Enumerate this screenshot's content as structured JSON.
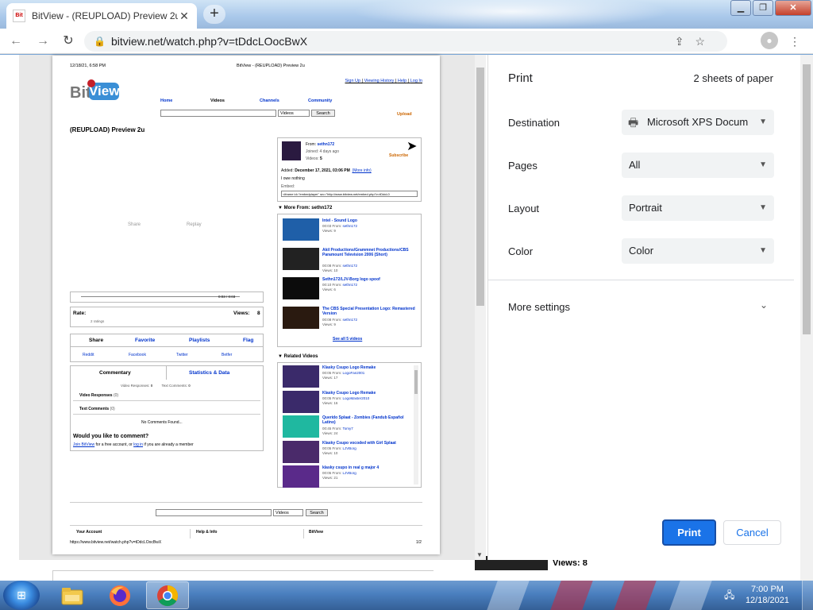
{
  "browser": {
    "tab_title": "BitView - (REUPLOAD) Preview 2u",
    "tab_favicon": "Bit",
    "url": "bitview.net/watch.php?v=tDdcLOocBwX"
  },
  "sheet": {
    "header_datetime": "12/18/21, 6:58 PM",
    "header_title": "BitView - (REUPLOAD) Preview 2u",
    "logo_bit": "Bit",
    "logo_view": "View",
    "toplinks": {
      "signup": "Sign Up",
      "history": "Viewing History",
      "help": "Help",
      "login": "Log In"
    },
    "nav": {
      "home": "Home",
      "videos": "Videos",
      "channels": "Channels",
      "community": "Community"
    },
    "search": {
      "select": "Videos",
      "button": "Search"
    },
    "upload": "Upload",
    "video_title": "(REUPLOAD) Preview 2u",
    "player": {
      "share": "Share",
      "replay": "Replay",
      "time": "0:03 / 0:03"
    },
    "rate": {
      "label": "Rate:",
      "ratings": "2 ratings",
      "views_label": "Views:",
      "views": "8"
    },
    "action_tabs": {
      "share": "Share",
      "favorite": "Favorite",
      "playlists": "Playlists",
      "flag": "Flag"
    },
    "share_links": {
      "reddit": "Reddit",
      "facebook": "Facebook",
      "twitter": "Twitter",
      "bsky": "Betfer"
    },
    "comment_tabs": {
      "commentary": "Commentary",
      "stats": "Statistics & Data"
    },
    "responses": {
      "video_responses_label": "Video Responses:",
      "video_responses": "0",
      "text_comments_label": "Text Comments:",
      "text_comments": "0"
    },
    "video_responses_heading": "Video Responses",
    "video_responses_count": "(0)",
    "text_comments_heading": "Text Comments",
    "text_comments_count": "(0)",
    "no_comments": "No Comments Found...",
    "would_like": "Would you like to comment?",
    "join_text_1": "Join BitView",
    "join_text_2": " for a free account, or ",
    "join_text_3": "log in",
    "join_text_4": " if you are already a member",
    "uploader": {
      "from_label": "From:",
      "from": "sethn172",
      "joined": "Joined: 4 days ago",
      "videos_label": "Videos:",
      "videos": "5",
      "subscribe": "Subscribe",
      "added_label": "Added:",
      "added": "December 17, 2021, 03:06 PM",
      "more_info": "(More info)",
      "description": "I owe nothing",
      "embed_label": "Embed:",
      "embed_code": "<iframe id=\"embedplayer\" src=\"http://www.bitview.net/embed.php?v=tDdcL0"
    },
    "more_from": {
      "heading": "More From: sethn172",
      "items": [
        {
          "title": "Intel - Sound Logo",
          "meta": "00:03 From:",
          "author": "sethn172",
          "views": "Views: 9"
        },
        {
          "title": "Akil Productions/Grammnet Productions/CBS Paramount Television 2006 (Short)",
          "meta": "00:08 From:",
          "author": "sethn172",
          "views": "Views: 10"
        },
        {
          "title": "Sethn172/LJV-Borg logo spoof",
          "meta": "00:10 From:",
          "author": "sethn172",
          "views": "Views: 6"
        },
        {
          "title": "The CBS Special Presentation Logo: Remastered Version",
          "meta": "00:08 From:",
          "author": "sethn172",
          "views": "Views: 9"
        }
      ],
      "see_all": "See all 5 videos"
    },
    "related": {
      "heading": "Related Videos",
      "items": [
        {
          "title": "Klasky Csupo Logo Remake",
          "meta": "00:05 From:",
          "author": "LogoFan2001",
          "views": "Views: 17"
        },
        {
          "title": "Klasky Csupo Logo Remake",
          "meta": "00:05 From:",
          "author": "LogoMaster2010",
          "views": "Views: 16"
        },
        {
          "title": "Querido Splaat - Zombies (Fandub Español Latino)",
          "meta": "00:45 From:",
          "author": "Tomy7",
          "views": "Views: 24"
        },
        {
          "title": "Klasky Csupo vocoded with Girl Splaat",
          "meta": "00:05 From:",
          "author": "LJVBorg",
          "views": "Views: 10"
        },
        {
          "title": "klasky csupo in real g major 4",
          "meta": "00:05 From:",
          "author": "LJVBorg",
          "views": "Views: 21"
        }
      ]
    },
    "footer": {
      "search_select": "Videos",
      "search_button": "Search",
      "your_account": "Your Account",
      "help_info": "Help & Info",
      "bitview": "BitView"
    },
    "footer_url": "https://www.bitview.net/watch.php?v=tDdcLOocBwX",
    "page_num": "1/2"
  },
  "print_dialog": {
    "title": "Print",
    "sheets": "2 sheets of paper",
    "destination_label": "Destination",
    "destination_value": "Microsoft XPS Docum",
    "pages_label": "Pages",
    "pages_value": "All",
    "layout_label": "Layout",
    "layout_value": "Portrait",
    "color_label": "Color",
    "color_value": "Color",
    "more_settings": "More settings",
    "print_button": "Print",
    "cancel_button": "Cancel"
  },
  "behind": {
    "views": "Views: 8"
  },
  "taskbar": {
    "time": "7:00 PM",
    "date": "12/18/2021"
  },
  "colors": {
    "accent": "#1a73e8",
    "bitview_link": "#0033cc",
    "upload": "#cc6600"
  }
}
